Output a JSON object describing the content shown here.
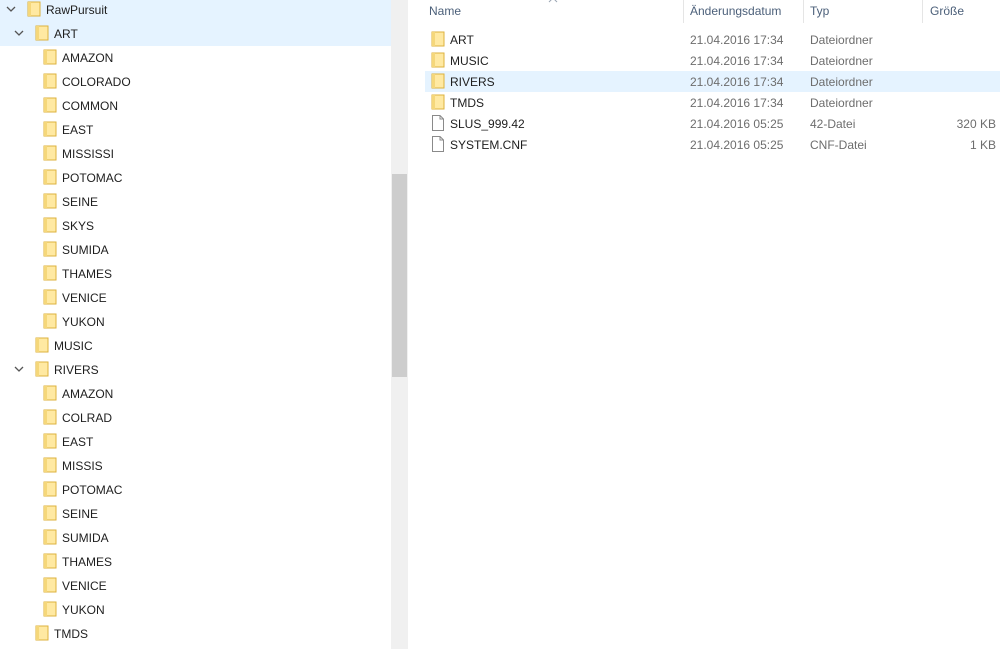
{
  "tree": {
    "root": {
      "label": "RawPursuit",
      "expanded": true,
      "selected": true
    },
    "art": {
      "label": "ART",
      "expanded": true,
      "children": [
        "AMAZON",
        "COLORADO",
        "COMMON",
        "EAST",
        "MISSISSI",
        "POTOMAC",
        "SEINE",
        "SKYS",
        "SUMIDA",
        "THAMES",
        "VENICE",
        "YUKON"
      ]
    },
    "music": {
      "label": "MUSIC"
    },
    "rivers": {
      "label": "RIVERS",
      "expanded": true,
      "children": [
        "AMAZON",
        "COLRAD",
        "EAST",
        "MISSIS",
        "POTOMAC",
        "SEINE",
        "SUMIDA",
        "THAMES",
        "VENICE",
        "YUKON"
      ]
    },
    "tmds": {
      "label": "TMDS"
    }
  },
  "list": {
    "columns": {
      "name": "Name",
      "date": "Änderungsdatum",
      "type": "Typ",
      "size": "Größe"
    },
    "sort_indicator_icon": "chevron-up-icon",
    "rows": [
      {
        "icon": "folder-icon",
        "name": "ART",
        "date": "21.04.2016 17:34",
        "type": "Dateiordner",
        "size": ""
      },
      {
        "icon": "folder-icon",
        "name": "MUSIC",
        "date": "21.04.2016 17:34",
        "type": "Dateiordner",
        "size": ""
      },
      {
        "icon": "folder-icon",
        "name": "RIVERS",
        "date": "21.04.2016 17:34",
        "type": "Dateiordner",
        "size": "",
        "hovered": true
      },
      {
        "icon": "folder-icon",
        "name": "TMDS",
        "date": "21.04.2016 17:34",
        "type": "Dateiordner",
        "size": ""
      },
      {
        "icon": "file-icon",
        "name": "SLUS_999.42",
        "date": "21.04.2016 05:25",
        "type": "42-Datei",
        "size": "320 KB"
      },
      {
        "icon": "file-icon",
        "name": "SYSTEM.CNF",
        "date": "21.04.2016 05:25",
        "type": "CNF-Datei",
        "size": "1 KB"
      }
    ]
  },
  "colors": {
    "selection": "#e5f3ff",
    "folder_fill": "#ffe9a2",
    "folder_edge": "#dcb23e",
    "header_text": "#4c607a"
  }
}
